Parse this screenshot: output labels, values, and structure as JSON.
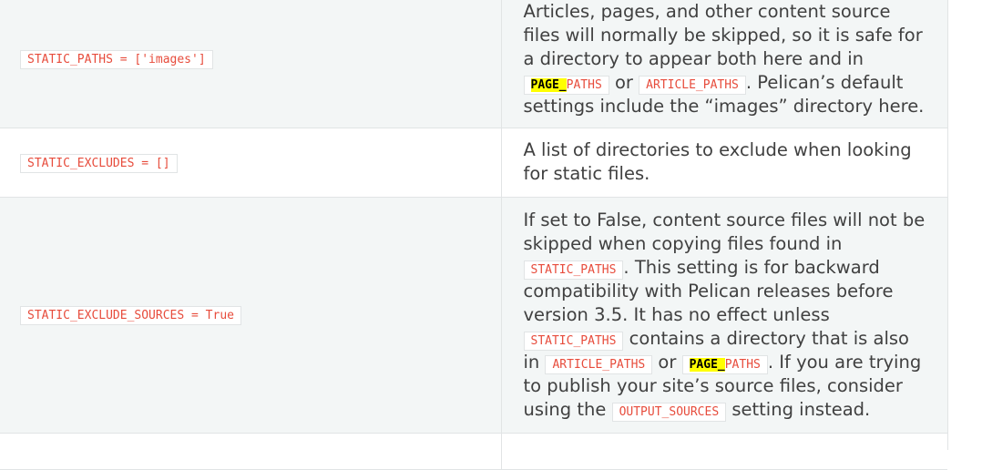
{
  "rows": [
    {
      "setting": "STATIC_PATHS = ['images']",
      "desc": {
        "t1": "Articles, pages, and other content source files will normally be skipped, so it is safe for a directory to appear both here and in ",
        "c1_hl": "PAGE_",
        "c1_rest": "PATHS",
        "t2": " or ",
        "c2": "ARTICLE_PATHS",
        "t3": ". Pelican’s default settings include the “images” directory here."
      }
    },
    {
      "setting": "STATIC_EXCLUDES = []",
      "desc": {
        "t1": "A list of directories to exclude when looking for static files."
      }
    },
    {
      "setting": "STATIC_EXCLUDE_SOURCES = True",
      "desc": {
        "t1": "If set to False, content source files will not be skipped when copying files found in ",
        "c1": "STATIC_PATHS",
        "t2": ". This setting is for backward compatibility with Pelican releases before version 3.5. It has no effect unless ",
        "c2": "STATIC_PATHS",
        "t3": " contains a directory that is also in ",
        "c3": "ARTICLE_PATHS",
        "t4": " or ",
        "c4_hl": "PAGE_",
        "c4_rest": "PATHS",
        "t5": ". If you are trying to publish your site’s source files, consider using the ",
        "c5": "OUTPUT_SOURCES",
        "t6": " setting instead."
      }
    }
  ],
  "colors": {
    "code_text": "#e74c3c",
    "highlight": "#ffff00",
    "row_alt": "#f3f6f6",
    "border": "#e1e4e5"
  }
}
